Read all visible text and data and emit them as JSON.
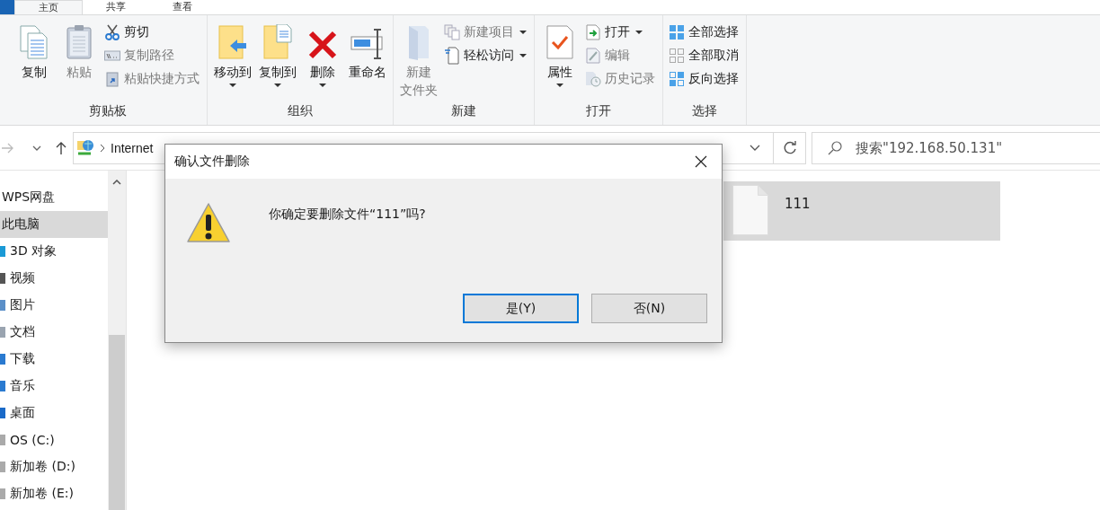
{
  "tabs": [
    {
      "label": "主页",
      "selected": true
    },
    {
      "label": "共享",
      "selected": false
    },
    {
      "label": "查看",
      "selected": false
    }
  ],
  "ribbon": [
    {
      "label": "剪贴板",
      "items": [
        {
          "kind": "large",
          "label": "复制",
          "disabled": false,
          "dropdown": false
        },
        {
          "kind": "large",
          "label": "粘贴",
          "disabled": true,
          "dropdown": false
        },
        {
          "kind": "stack",
          "items": [
            {
              "label": "剪切",
              "disabled": false,
              "dropdown": false
            },
            {
              "label": "复制路径",
              "disabled": true,
              "dropdown": false
            },
            {
              "label": "粘贴快捷方式",
              "disabled": true,
              "dropdown": false
            }
          ]
        }
      ]
    },
    {
      "label": "组织",
      "items": [
        {
          "kind": "large",
          "label": "移动到",
          "disabled": false,
          "dropdown": true
        },
        {
          "kind": "large",
          "label": "复制到",
          "disabled": false,
          "dropdown": true
        },
        {
          "kind": "large",
          "label": "删除",
          "disabled": false,
          "dropdown": true
        },
        {
          "kind": "large",
          "label": "重命名",
          "disabled": false,
          "dropdown": false
        }
      ]
    },
    {
      "label": "新建",
      "items": [
        {
          "kind": "large",
          "lines": [
            "新建",
            "文件夹"
          ],
          "disabled": true,
          "dropdown": false
        },
        {
          "kind": "stack",
          "items": [
            {
              "label": "新建项目",
              "disabled": true,
              "dropdown": true
            },
            {
              "label": "轻松访问",
              "disabled": false,
              "dropdown": true
            }
          ]
        }
      ]
    },
    {
      "label": "打开",
      "items": [
        {
          "kind": "large",
          "label": "属性",
          "disabled": false,
          "dropdown": true
        },
        {
          "kind": "stack",
          "items": [
            {
              "label": "打开",
              "disabled": false,
              "dropdown": true
            },
            {
              "label": "编辑",
              "disabled": true,
              "dropdown": false
            },
            {
              "label": "历史记录",
              "disabled": true,
              "dropdown": false
            }
          ]
        }
      ]
    },
    {
      "label": "选择",
      "items": [
        {
          "kind": "stack",
          "items": [
            {
              "label": "全部选择",
              "disabled": false,
              "dropdown": false
            },
            {
              "label": "全部取消",
              "disabled": false,
              "dropdown": false
            },
            {
              "label": "反向选择",
              "disabled": false,
              "dropdown": false
            }
          ]
        }
      ]
    }
  ],
  "address": {
    "path": "Internet",
    "search_placeholder": "搜索\"192.168.50.131\""
  },
  "sidebar": [
    {
      "label": "WPS网盘",
      "selected": false
    },
    {
      "label": "此电脑",
      "selected": true
    },
    {
      "label": "3D 对象",
      "selected": false
    },
    {
      "label": "视频",
      "selected": false
    },
    {
      "label": "图片",
      "selected": false
    },
    {
      "label": "文档",
      "selected": false
    },
    {
      "label": "下载",
      "selected": false
    },
    {
      "label": "音乐",
      "selected": false
    },
    {
      "label": "桌面",
      "selected": false
    },
    {
      "label": "OS (C:)",
      "selected": false
    },
    {
      "label": "新加卷 (D:)",
      "selected": false
    },
    {
      "label": "新加卷 (E:)",
      "selected": false
    }
  ],
  "files": [
    {
      "name": "111",
      "selected": true
    }
  ],
  "dialog": {
    "title": "确认文件删除",
    "message": "你确定要删除文件“111”吗?",
    "buttons": [
      {
        "label": "是(Y)",
        "selected": true
      },
      {
        "label": "否(N)",
        "selected": false
      }
    ]
  }
}
